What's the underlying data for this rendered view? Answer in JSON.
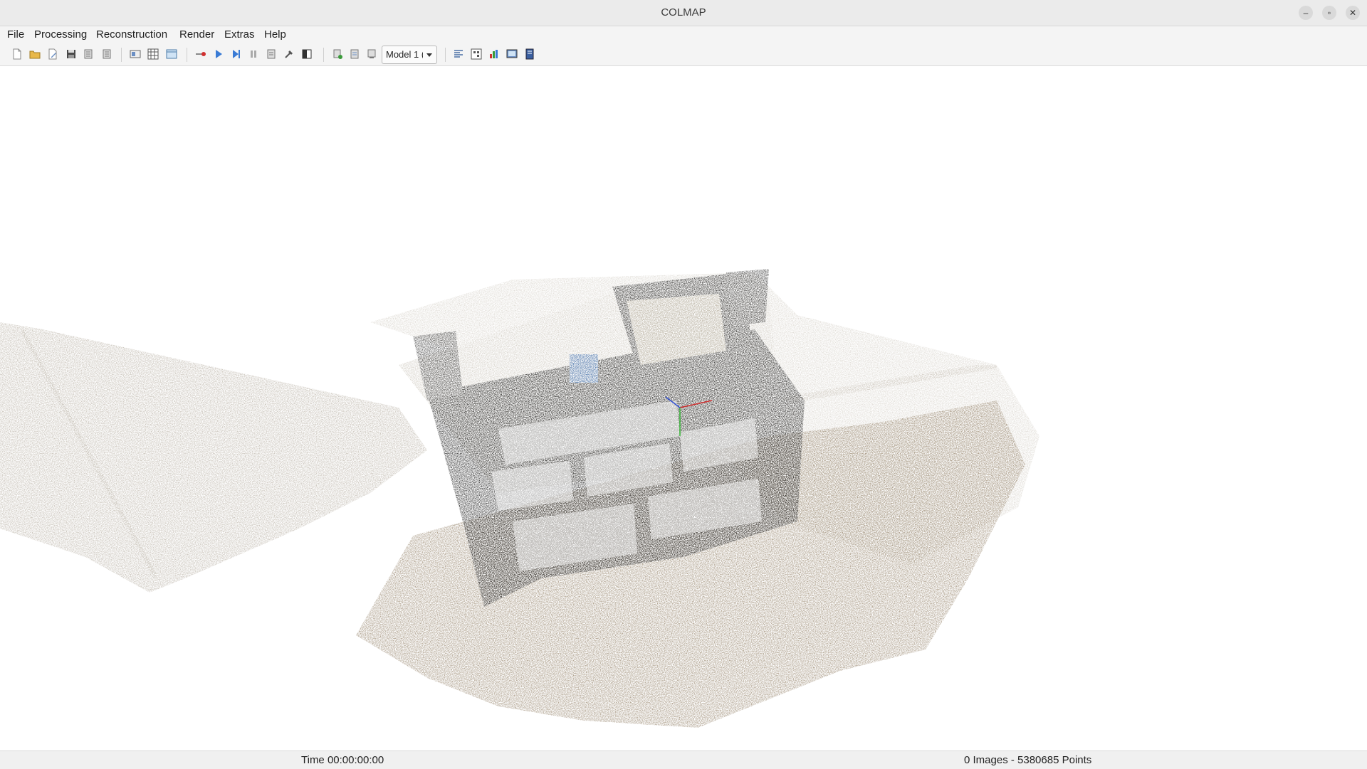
{
  "window": {
    "title": "COLMAP",
    "controls": {
      "minimize": "–",
      "maximize": "▫",
      "close": "✕"
    }
  },
  "menu": [
    "File",
    "Processing",
    "Reconstruction",
    "Render",
    "Extras",
    "Help"
  ],
  "toolbar": {
    "model_select": {
      "value": "Model 1 ("
    },
    "icons": [
      "new-project-icon",
      "open-project-icon",
      "edit-project-icon",
      "save-project-icon",
      "import-model-icon",
      "export-model-icon",
      "feature-extraction-icon",
      "feature-matching-icon",
      "database-management-icon",
      "automatic-reconstruction-icon",
      "start-reconstruction-icon",
      "step-reconstruction-icon",
      "pause-reconstruction-icon",
      "reset-reconstruction-icon",
      "bundle-adjustment-icon",
      "grab-image-icon",
      "grab-movie-icon",
      "undistortion-icon",
      "stereo-icon",
      "fusion-icon",
      "render-options-icon",
      "reconstruction-stats-icon",
      "match-matrix-icon",
      "log-window-icon",
      "viewer-icon"
    ]
  },
  "viewport": {
    "description_visible": false
  },
  "status": {
    "time": "Time 00:00:00:00",
    "summary": "0 Images - 5380685 Points"
  },
  "colors": {
    "background": "#ffffff",
    "floor": "#a89a86",
    "dark_points": "#2b2b2b",
    "wall_points": "#cfc8bd"
  }
}
